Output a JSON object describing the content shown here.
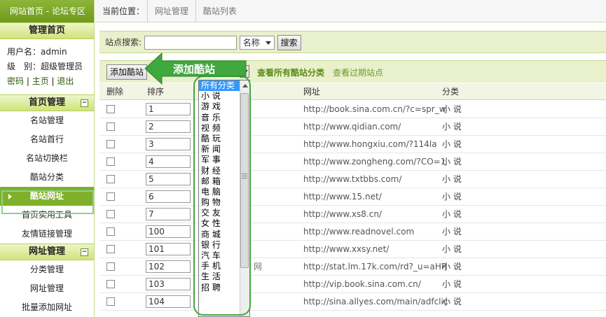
{
  "sidebar": {
    "logo": "网站首页 - 论坛专区",
    "admin_head": "管理首页",
    "username_line": "用户名：admin",
    "level_line": "级　别：超级管理员",
    "links": [
      "密码",
      "主页",
      "退出"
    ],
    "sections": [
      {
        "title": "首页管理",
        "items": [
          "名站管理",
          "名站首行",
          "名站切换栏",
          "酷站分类",
          "酷站网址",
          "首页实用工具",
          "友情链接管理"
        ],
        "active_index": 4
      },
      {
        "title": "网址管理",
        "items": [
          "分类管理",
          "网址管理",
          "批量添加网址"
        ]
      }
    ]
  },
  "breadcrumb": {
    "label": "当前位置：",
    "items": [
      "网址管理",
      "酷站列表"
    ]
  },
  "search": {
    "label": "站点搜索:",
    "value": "",
    "field_select": "名称",
    "button": "搜索"
  },
  "actions": {
    "add_button": "添加酷站",
    "callout": "添加酷站",
    "link_all": "查看所有酷站分类",
    "link_expired": "查看过期站点"
  },
  "table": {
    "headers": [
      "删除",
      "排序",
      "网址",
      "分类"
    ],
    "rows": [
      {
        "order": "1",
        "url": "http://book.sina.com.cn/?c=spr_w",
        "cat": "小 说",
        "name": ""
      },
      {
        "order": "2",
        "url": "http://www.qidian.com/",
        "cat": "小 说",
        "name": ""
      },
      {
        "order": "3",
        "url": "http://www.hongxiu.com/?114la",
        "cat": "小 说",
        "name": ""
      },
      {
        "order": "4",
        "url": "http://www.zongheng.com/?CO=1",
        "cat": "小 说",
        "name": ""
      },
      {
        "order": "5",
        "url": "http://www.txtbbs.com/",
        "cat": "小 说",
        "name": ""
      },
      {
        "order": "6",
        "url": "http://www.15.net/",
        "cat": "小 说",
        "name": ""
      },
      {
        "order": "7",
        "url": "http://www.xs8.cn/",
        "cat": "小 说",
        "name": ""
      },
      {
        "order": "100",
        "url": "http://www.readnovel.com",
        "cat": "小 说",
        "name": ""
      },
      {
        "order": "101",
        "url": "http://www.xxsy.net/",
        "cat": "小 说",
        "name": ""
      },
      {
        "order": "102",
        "url": "http://stat.lm.17k.com/rd?_u=aHR",
        "cat": "小 说",
        "name": "网"
      },
      {
        "order": "103",
        "url": "http://vip.book.sina.com.cn/",
        "cat": "小 说",
        "name": ""
      },
      {
        "order": "104",
        "url": "http://sina.allyes.com/main/adfclic",
        "cat": "小 说",
        "name": ""
      }
    ]
  },
  "category_dropdown": {
    "options": [
      "所有分类",
      "小 说",
      "游 戏",
      "音 乐",
      "视 频",
      "酷 玩",
      "新 闻",
      "军 事",
      "财 经",
      "邮 箱",
      "电 脑",
      "购 物",
      "交 友",
      "女 性",
      "商 城",
      "银 行",
      "汽 车",
      "手 机",
      "生 活",
      "招 聘"
    ],
    "selected_index": 0
  },
  "colors": {
    "accent": "#7fb02a",
    "callout": "#3fa83f",
    "link": "#5b8b1a"
  }
}
